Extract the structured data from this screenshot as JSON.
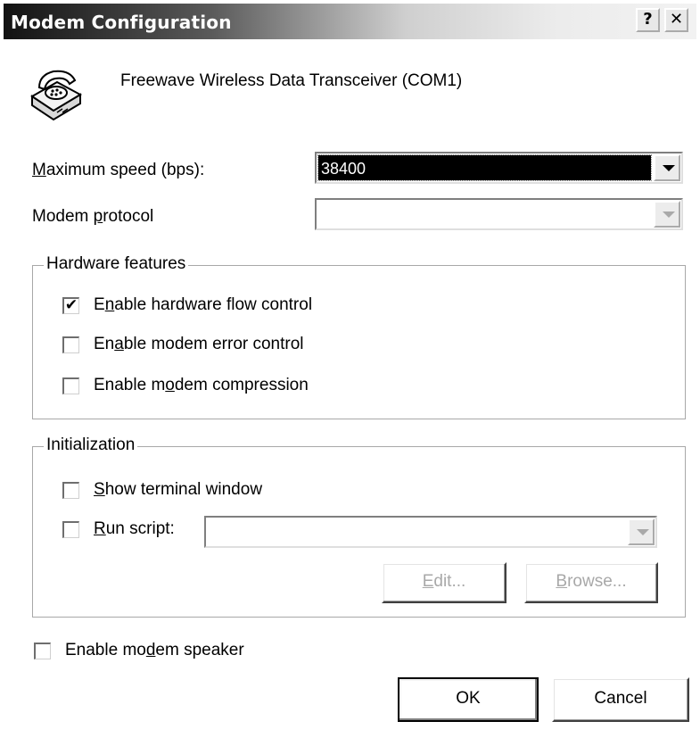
{
  "window": {
    "title": "Modem Configuration",
    "help_glyph": "?",
    "close_glyph": "✕"
  },
  "device": {
    "icon": "telephone-icon",
    "name": "Freewave Wireless Data Transceiver (COM1)"
  },
  "max_speed": {
    "label_prefix": "M",
    "label_rest": "aximum speed (bps):",
    "value": "38400"
  },
  "protocol": {
    "label_pre": "Modem ",
    "label_u": "p",
    "label_post": "rotocol",
    "value": ""
  },
  "hardware": {
    "title": "Hardware features",
    "flow": {
      "pre": "E",
      "u": "n",
      "post": "able hardware flow control",
      "checked": true,
      "mark": "✔"
    },
    "error": {
      "pre": "En",
      "u": "a",
      "post": "ble modem error control",
      "checked": false
    },
    "compression": {
      "pre": "Enable m",
      "u": "o",
      "post": "dem compression",
      "checked": false
    }
  },
  "init": {
    "title": "Initialization",
    "terminal": {
      "u": "S",
      "post": "how terminal window",
      "checked": false
    },
    "script": {
      "u": "R",
      "post": "un script:",
      "checked": false,
      "value": ""
    },
    "edit": {
      "u": "E",
      "post": "dit..."
    },
    "browse": {
      "u": "B",
      "post": "rowse..."
    }
  },
  "speaker": {
    "pre": "Enable mo",
    "u": "d",
    "post": "em speaker",
    "checked": false
  },
  "buttons": {
    "ok": "OK",
    "cancel": "Cancel"
  },
  "colors": {
    "title_start": "#121212",
    "title_end": "#f2f2f2",
    "selection": "#000000"
  }
}
